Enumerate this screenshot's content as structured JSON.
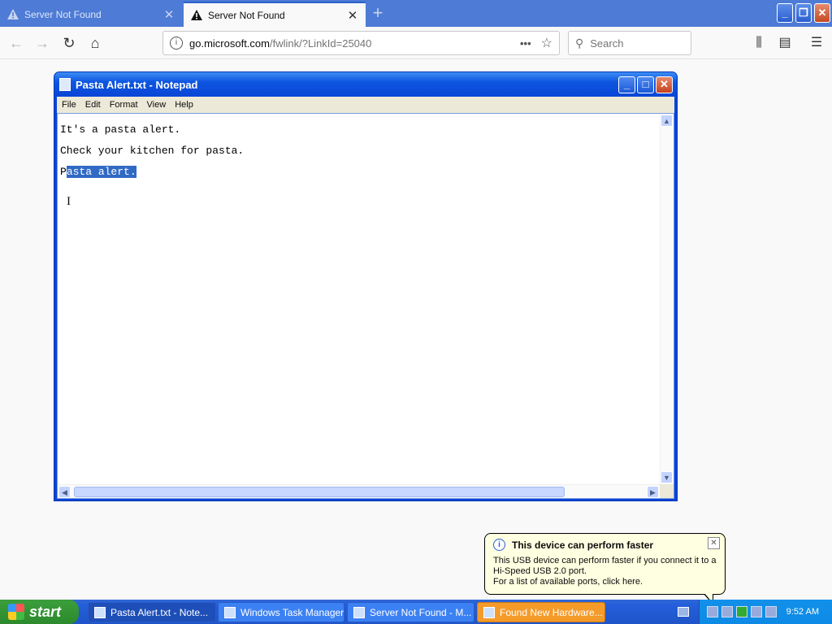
{
  "browser": {
    "tabs": [
      {
        "label": "Server Not Found",
        "active": false
      },
      {
        "label": "Server Not Found",
        "active": true
      }
    ],
    "new_tab_label": "+",
    "url_domain": "go.microsoft.com",
    "url_path": "/fwlink/?LinkId=25040",
    "search_placeholder": "Search",
    "page_actions_label": "•••"
  },
  "notepad": {
    "title": "Pasta Alert.txt - Notepad",
    "menu": [
      "File",
      "Edit",
      "Format",
      "View",
      "Help"
    ],
    "lines": [
      "It's a pasta alert.",
      "Check your kitchen for pasta."
    ],
    "line3_unselected": "P",
    "line3_selected": "asta alert."
  },
  "balloon": {
    "title": "This device can perform faster",
    "body_line1": "This USB device can perform faster if you connect it to a",
    "body_line2": "Hi-Speed USB 2.0 port.",
    "body_line3": "For a list of available ports, click here."
  },
  "taskbar": {
    "start_label": "start",
    "buttons": [
      {
        "label": "Pasta Alert.txt - Note...",
        "state": "active"
      },
      {
        "label": "Windows Task Manager",
        "state": "normal"
      },
      {
        "label": "Server Not Found - M...",
        "state": "normal"
      },
      {
        "label": "Found New Hardware...",
        "state": "flashing"
      }
    ],
    "clock": "9:52 AM"
  },
  "colors": {
    "firefox_titlebar": "#4d7bd6",
    "xp_blue": "#245edb",
    "selection": "#316ac5",
    "flash_button": "#f59b2a"
  }
}
